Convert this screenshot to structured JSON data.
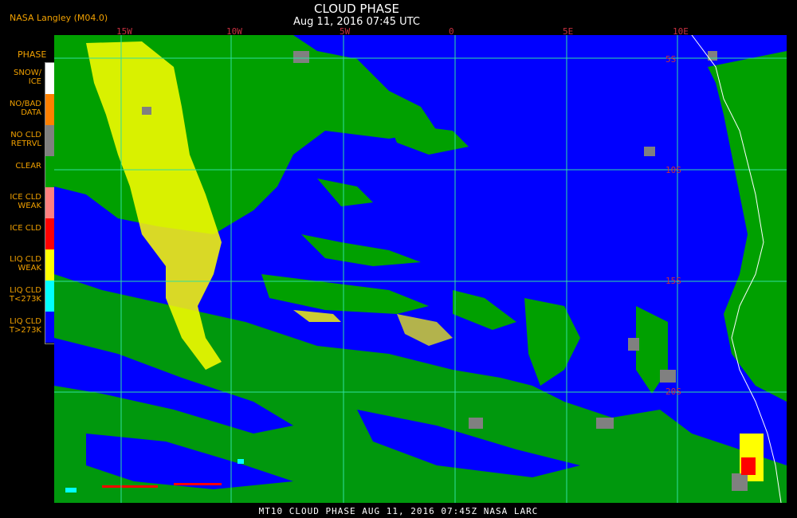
{
  "header": {
    "producer": "NASA Langley (M04.0)",
    "title": "CLOUD PHASE",
    "subtitle": "Aug 11, 2016 07:45 UTC"
  },
  "longitude_labels": [
    "15W",
    "10W",
    "5W",
    "0",
    "5E",
    "10E"
  ],
  "latitude_labels": [
    "5S",
    "10S",
    "15S",
    "20S"
  ],
  "legend": {
    "title": "PHASE",
    "items": [
      {
        "label": "SNOW/\nICE",
        "color": "#ffffff"
      },
      {
        "label": "NO/BAD\nDATA",
        "color": "#ff8000"
      },
      {
        "label": "NO CLD\nRETRVL",
        "color": "#808080"
      },
      {
        "label": "CLEAR",
        "color": "#00a000"
      },
      {
        "label": "ICE CLD\nWEAK",
        "color": "#ff8080"
      },
      {
        "label": "ICE CLD",
        "color": "#ff0000"
      },
      {
        "label": "LIQ CLD\nWEAK",
        "color": "#ffff00"
      },
      {
        "label": "LIQ CLD\nT<273K",
        "color": "#00ffff"
      },
      {
        "label": "LIQ CLD\nT>273K",
        "color": "#0000ff"
      }
    ]
  },
  "colors": {
    "ocean_clear": "#00a000",
    "liquid_warm": "#0000ff",
    "liquid_weak": "#ffff00",
    "no_retrieval": "#808080",
    "ice": "#ff0000",
    "grid": "#30e0a0",
    "coastline": "#ffffff"
  },
  "footer": {
    "text": "MT10  CLOUD PHASE  AUG 11, 2016 07:45Z  NASA LARC"
  }
}
